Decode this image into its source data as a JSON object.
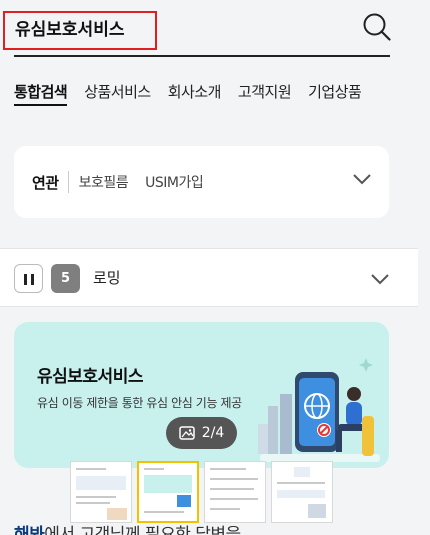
{
  "search": {
    "query": "유심보호서비스"
  },
  "tabs": [
    {
      "label": "통합검색",
      "active": true
    },
    {
      "label": "상품서비스",
      "active": false
    },
    {
      "label": "회사소개",
      "active": false
    },
    {
      "label": "고객지원",
      "active": false
    },
    {
      "label": "기업상품",
      "active": false
    }
  ],
  "related": {
    "label": "연관",
    "keywords": [
      "보호필름",
      "USIM가입"
    ]
  },
  "trending": {
    "rank": "5",
    "keyword": "로밍"
  },
  "banner": {
    "title": "유심보호서비스",
    "description": "유심 이동 제한을 통한 유심 안심 기능 제공",
    "page_indicator": "2/4",
    "background": "#c8f1ee"
  },
  "thumbnails": [
    {
      "index": 1,
      "selected": false
    },
    {
      "index": 2,
      "selected": true
    },
    {
      "index": 3,
      "selected": false
    },
    {
      "index": 4,
      "selected": false
    }
  ],
  "bottom": {
    "highlight": "해봐",
    "text": "에서 고객님께 필요한 답변을"
  },
  "colors": {
    "highlight_border": "#e02020",
    "selected_thumb": "#f2c200",
    "banner_bg": "#c8f1ee"
  }
}
